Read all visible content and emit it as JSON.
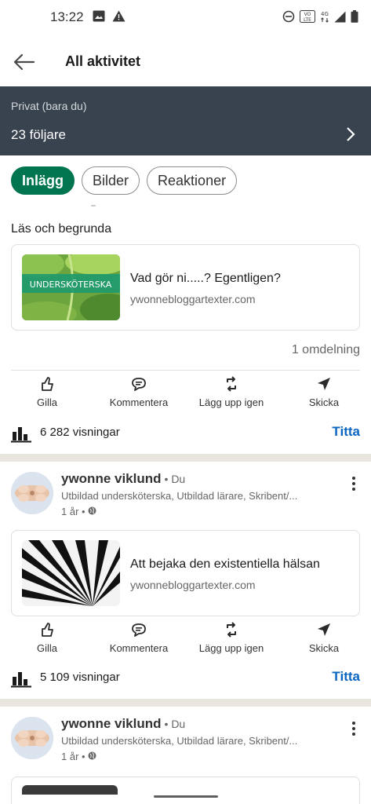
{
  "status_bar": {
    "time": "13:22",
    "left_icons": [
      "image-icon",
      "warning-icon"
    ],
    "right_icons": [
      "dnd-icon",
      "volte-icon",
      "4g-icon",
      "signal-icon",
      "battery-icon"
    ]
  },
  "app_bar": {
    "back_icon": "back-arrow-icon",
    "title": "All aktivitet"
  },
  "privacy": {
    "subtitle": "Privat (bara du)",
    "followers": "23 följare"
  },
  "filters": [
    {
      "label": "Inlägg",
      "active": true
    },
    {
      "label": "Bilder",
      "active": false
    },
    {
      "label": "Reaktioner",
      "active": false
    }
  ],
  "posts": [
    {
      "text": "Läs och begrunda",
      "link": {
        "thumb_text": "UNDERSKÖTERSKA",
        "title": "Vad gör ni.....? Egentligen?",
        "domain": "ywonnebloggartexter.com"
      },
      "shares": "1 omdelning",
      "views": "6 282 visningar",
      "views_button": "Titta"
    },
    {
      "author": {
        "name": "ywonne viklund",
        "du": "• Du",
        "headline": "Utbildad undersköterska, Utbildad lärare, Skribent/...",
        "time": "1 år •"
      },
      "link": {
        "title": "Att bejaka den existentiella hälsan",
        "domain": "ywonnebloggartexter.com"
      },
      "views": "5 109 visningar",
      "views_button": "Titta"
    },
    {
      "author": {
        "name": "ywonne viklund",
        "du": "• Du",
        "headline": "Utbildad undersköterska, Utbildad lärare, Skribent/...",
        "time": "1 år •"
      }
    }
  ],
  "actions": {
    "like": "Gilla",
    "comment": "Kommentera",
    "repost": "Lägg upp igen",
    "send": "Skicka"
  },
  "colors": {
    "brand_green": "#01754f",
    "banner": "#38434f",
    "link_blue": "#0a66c2",
    "separator": "#e9e5df"
  }
}
